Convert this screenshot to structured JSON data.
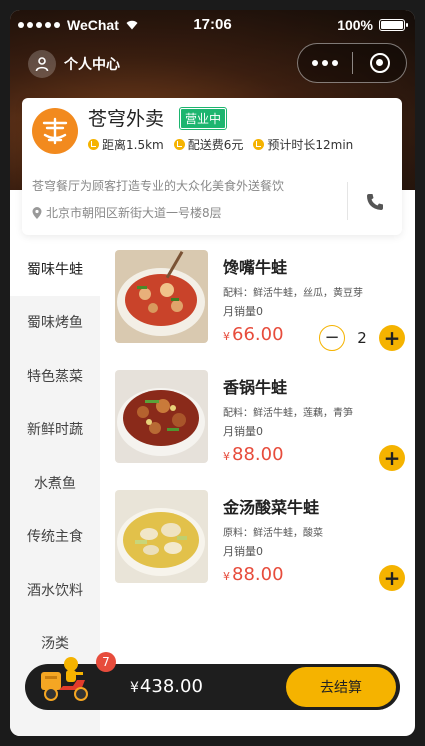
{
  "status_bar": {
    "carrier": "WeChat",
    "time": "17:06",
    "battery": "100%"
  },
  "nav": {
    "profile_label": "个人中心"
  },
  "shop": {
    "name": "苍穹外卖",
    "status_badge": "营业中",
    "meta": [
      {
        "icon": "distance-icon",
        "text": "距离1.5km"
      },
      {
        "icon": "delivery-fee-icon",
        "text": "配送费6元"
      },
      {
        "icon": "time-icon",
        "text": "预计时长12min"
      }
    ],
    "description": "苍穹餐厅为顾客打造专业的大众化美食外送餐饮",
    "address": "北京市朝阳区新街大道一号楼8层"
  },
  "categories": [
    "蜀味牛蛙",
    "蜀味烤鱼",
    "特色蒸菜",
    "新鲜时蔬",
    "水煮鱼",
    "传统主食",
    "酒水饮料",
    "汤类"
  ],
  "products": [
    {
      "name": "馋嘴牛蛙",
      "desc": "配料：鲜活牛蛙，丝瓜，黄豆芽",
      "sales": "月销量0",
      "currency": "¥",
      "price": "66.00",
      "qty": "2",
      "minus": "−",
      "plus": "+",
      "img_color": "#c9432a"
    },
    {
      "name": "香锅牛蛙",
      "desc": "配料：鲜活牛蛙，莲藕，青笋",
      "sales": "月销量0",
      "currency": "¥",
      "price": "88.00",
      "plus": "+",
      "img_color": "#8a2a1a"
    },
    {
      "name": "金汤酸菜牛蛙",
      "desc": "原料：鲜活牛蛙，酸菜",
      "sales": "月销量0",
      "currency": "¥",
      "price": "88.00",
      "plus": "+",
      "img_color": "#e2c14a"
    }
  ],
  "cart": {
    "count": "7",
    "currency": "¥",
    "total": "438.00",
    "checkout_label": "去结算"
  },
  "colors": {
    "accent": "#f5b300",
    "price": "#e74c3c",
    "open_badge": "#1db56f",
    "logo": "#f28a1e"
  }
}
